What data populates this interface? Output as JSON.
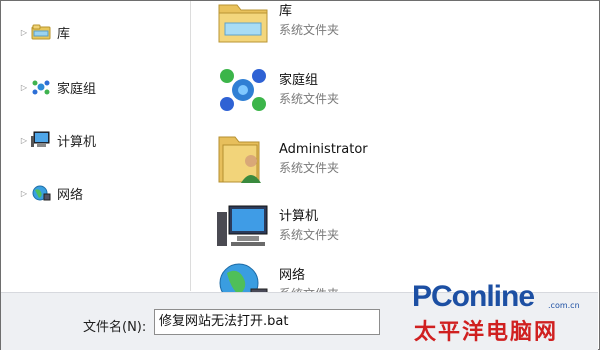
{
  "nav": {
    "items": [
      {
        "label": "库",
        "icon": "library-icon"
      },
      {
        "label": "家庭组",
        "icon": "homegroup-icon"
      },
      {
        "label": "计算机",
        "icon": "computer-icon"
      },
      {
        "label": "网络",
        "icon": "network-icon"
      }
    ]
  },
  "content": {
    "items": [
      {
        "name": "库",
        "type": "系统文件夹",
        "icon": "library-folder-icon"
      },
      {
        "name": "家庭组",
        "type": "系统文件夹",
        "icon": "homegroup-icon"
      },
      {
        "name": "Administrator",
        "type": "系统文件夹",
        "icon": "user-folder-icon"
      },
      {
        "name": "计算机",
        "type": "系统文件夹",
        "icon": "computer-icon"
      },
      {
        "name": "网络",
        "type": "系统文件夹",
        "icon": "network-globe-icon"
      }
    ]
  },
  "filename": {
    "label": "文件名(N):",
    "value": "修复网站无法打开.bat"
  },
  "watermark": {
    "brand": "PConline",
    "domain": ".com.cn",
    "cn": "太平洋电脑网"
  }
}
